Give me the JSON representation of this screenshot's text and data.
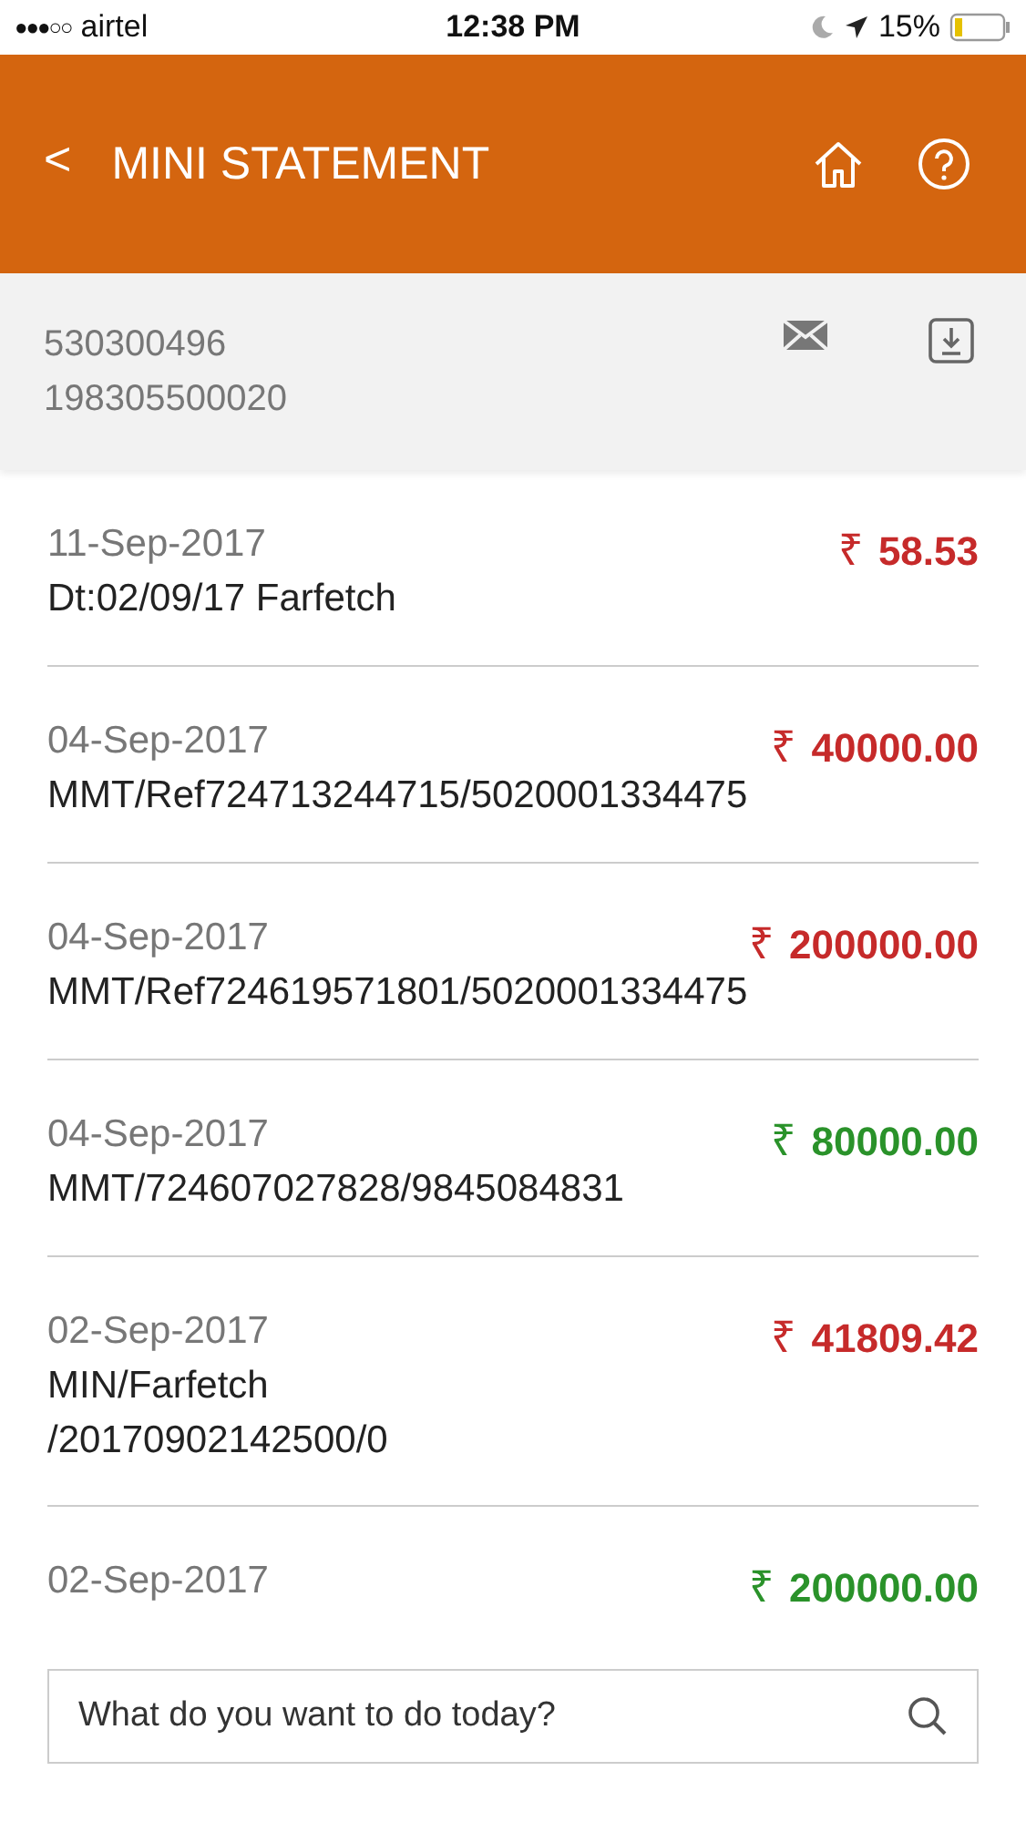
{
  "status_bar": {
    "signal": "●●●○○",
    "carrier": "airtel",
    "time": "12:38 PM",
    "battery": "15%"
  },
  "header": {
    "back": "<",
    "title": "MINI STATEMENT"
  },
  "account": {
    "lines": [
      "530300496",
      "198305500020"
    ]
  },
  "transactions": [
    {
      "date": "11-Sep-2017",
      "description": [
        "Dt:02/09/17 Farfetch"
      ],
      "currency": "₹",
      "amount": "58.53",
      "kind": "debit"
    },
    {
      "date": "04-Sep-2017",
      "description": [
        "MMT/Ref724713244715/5020001334475"
      ],
      "currency": "₹",
      "amount": "40000.00",
      "kind": "debit"
    },
    {
      "date": "04-Sep-2017",
      "description": [
        "MMT/Ref724619571801/5020001334475"
      ],
      "currency": "₹",
      "amount": "200000.00",
      "kind": "debit"
    },
    {
      "date": "04-Sep-2017",
      "description": [
        "MMT/724607027828/9845084831"
      ],
      "currency": "₹",
      "amount": "80000.00",
      "kind": "credit"
    },
    {
      "date": "02-Sep-2017",
      "description": [
        "MIN/Farfetch",
        "/20170902142500/0"
      ],
      "currency": "₹",
      "amount": "41809.42",
      "kind": "debit"
    },
    {
      "date": "02-Sep-2017",
      "currency": "₹",
      "amount": "200000.00",
      "kind": "credit"
    }
  ],
  "search": {
    "placeholder": "What do you want to do today?"
  }
}
